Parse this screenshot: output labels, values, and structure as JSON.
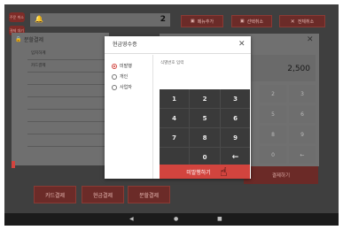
{
  "top_badges": [
    "주문 취소",
    "결제 대기"
  ],
  "header": {
    "count": "2"
  },
  "top_buttons": [
    {
      "label": "메뉴추가",
      "icon": "box-icon"
    },
    {
      "label": "선택취소",
      "icon": "box-icon"
    },
    {
      "label": "전체취소",
      "icon": "close-icon"
    }
  ],
  "split_panel": {
    "title": "분할결제",
    "items": [
      "입지하계",
      "카드결제"
    ]
  },
  "bg_keypad": {
    "amount": "2,500",
    "keys": [
      "2",
      "3",
      "5",
      "6",
      "8",
      "9",
      "0",
      "←"
    ],
    "pay_label": "결제하기"
  },
  "bottom_buttons": [
    "카드결제",
    "현금결제",
    "분할결제"
  ],
  "dialog": {
    "title": "현금영수증",
    "options": [
      {
        "label": "미발행",
        "selected": true
      },
      {
        "label": "개인",
        "selected": false
      },
      {
        "label": "사업자",
        "selected": false
      }
    ],
    "id_placeholder": "식별번호 입력",
    "keys": [
      "1",
      "2",
      "3",
      "4",
      "5",
      "6",
      "7",
      "8",
      "9",
      "",
      "0",
      "←"
    ],
    "action_label": "미발행하기"
  },
  "nav": [
    "◀",
    "●",
    "■"
  ],
  "colors": {
    "accent": "#d2443e",
    "dim_overlay": "#3f3f3f",
    "dialog_bg": "#ffffff"
  }
}
